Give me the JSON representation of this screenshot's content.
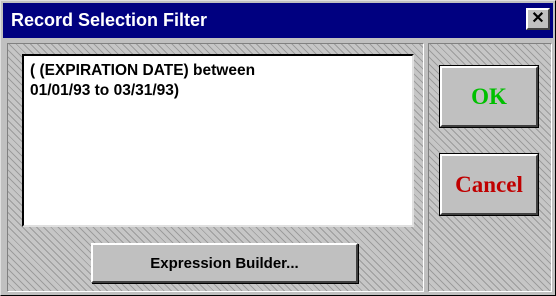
{
  "window": {
    "title": "Record Selection Filter",
    "close_glyph": "✕"
  },
  "filter": {
    "expression": "( (EXPIRATION DATE) between\n01/01/93 to 03/31/93)"
  },
  "buttons": {
    "expression_builder_label": "Expression Builder...",
    "ok_label": "OK",
    "cancel_label": "Cancel"
  },
  "colors": {
    "titlebar": "#000080",
    "ok_text": "#00c000",
    "cancel_text": "#c00000"
  },
  "icons": {
    "close": "close-icon"
  }
}
